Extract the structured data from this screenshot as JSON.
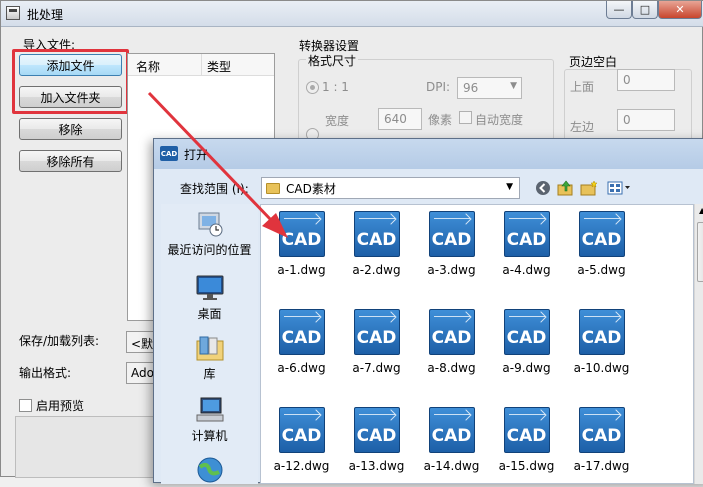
{
  "main_window": {
    "title": "批处理",
    "min_label": "—",
    "max_label": "□",
    "close_label": "✕",
    "import_group_label": "导入文件:",
    "buttons": {
      "add_file": "添加文件",
      "add_folder": "加入文件夹",
      "remove": "移除",
      "remove_all": "移除所有"
    },
    "list_columns": [
      "名称",
      "类型"
    ],
    "save_load_list_label": "保存/加载列表:",
    "save_load_value": "<默",
    "output_format_label": "输出格式:",
    "output_format_value": "Ado",
    "enable_preview_label": "启用预览",
    "converter_settings": {
      "title": "转换器设置",
      "format_size_label": "格式尺寸",
      "ratio_label": "1 : 1",
      "dpi_label": "DPI:",
      "dpi_value": "96",
      "width_label": "宽度",
      "width_value": "640",
      "pixel_label": "像素",
      "auto_width_label": "自动宽度"
    },
    "margins": {
      "title": "页边空白",
      "top_label": "上面",
      "top_value": "0",
      "left_label": "左边",
      "left_value": "0"
    }
  },
  "open_dialog": {
    "icon_text": "CAD",
    "title": "打开",
    "look_in_label": "查找范围 (I):",
    "look_in_value": "CAD素材",
    "places": [
      {
        "label": "最近访问的位置",
        "icon": "recent-places-icon"
      },
      {
        "label": "桌面",
        "icon": "desktop-icon"
      },
      {
        "label": "库",
        "icon": "libraries-icon"
      },
      {
        "label": "计算机",
        "icon": "computer-icon"
      },
      {
        "label": "",
        "icon": "network-icon"
      }
    ],
    "file_icon_text": "CAD",
    "files": [
      "a-1.dwg",
      "a-2.dwg",
      "a-3.dwg",
      "a-4.dwg",
      "a-5.dwg",
      "a-6.dwg",
      "a-7.dwg",
      "a-8.dwg",
      "a-9.dwg",
      "a-10.dwg",
      "a-12.dwg",
      "a-13.dwg",
      "a-14.dwg",
      "a-15.dwg",
      "a-17.dwg"
    ]
  },
  "colors": {
    "highlight_box": "#e0343d",
    "cad_icon_blue": "#1d5fa7",
    "dialog_chrome": "#dfe9f5"
  }
}
